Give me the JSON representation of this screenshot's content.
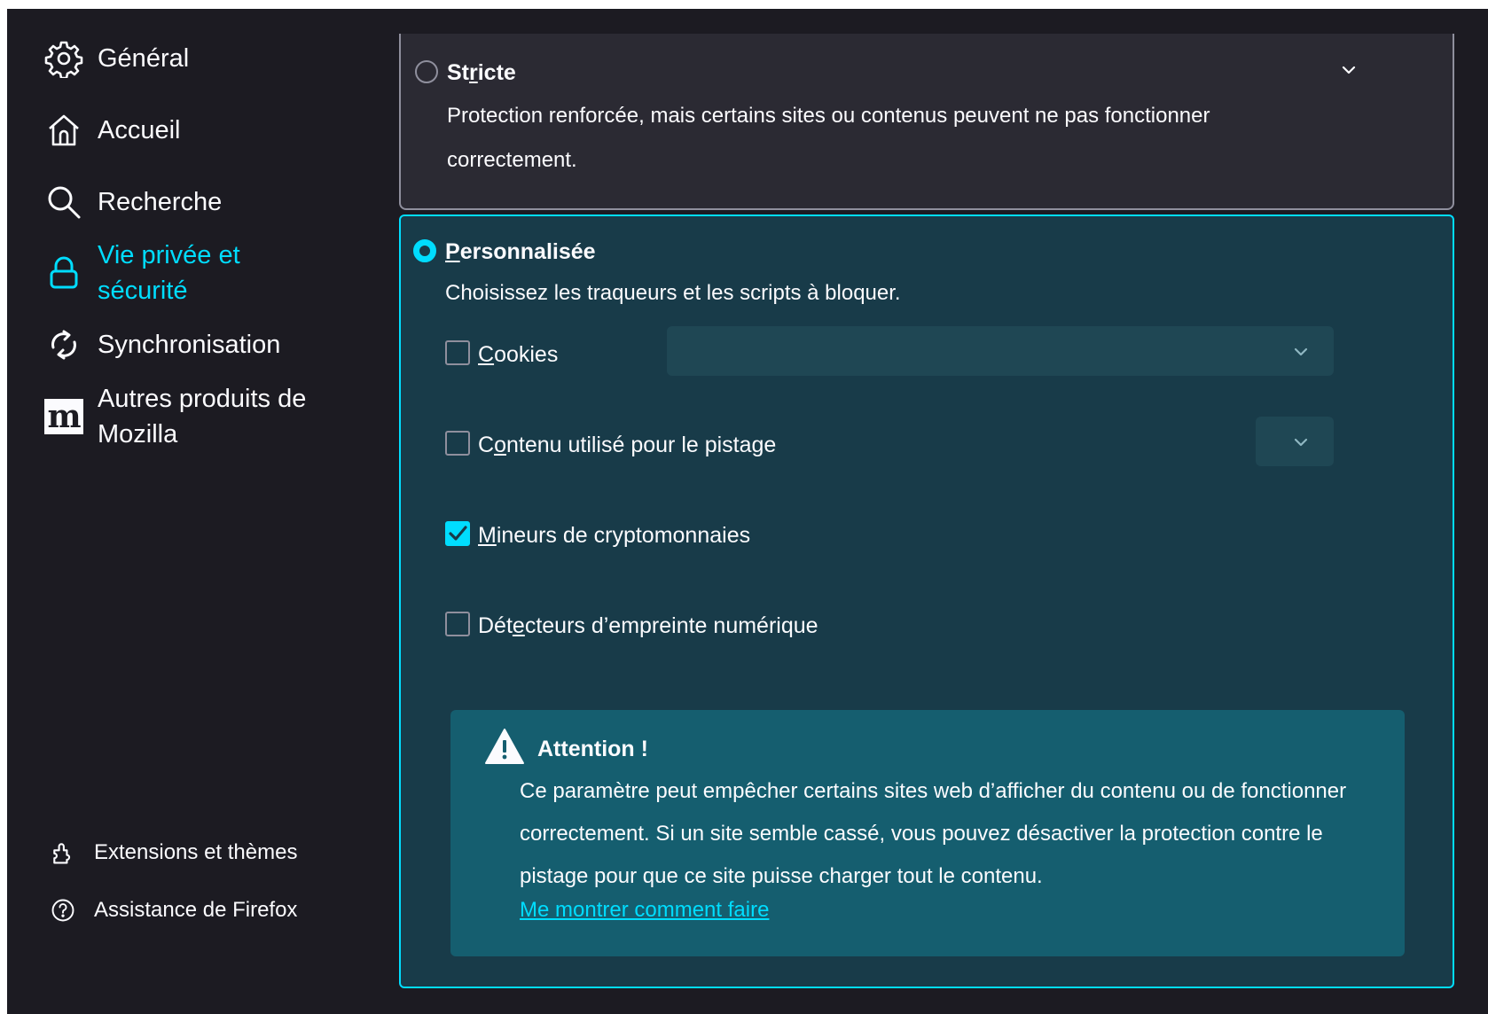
{
  "colors": {
    "background": "#1c1b22",
    "accent": "#00ddff",
    "text": "#fbfbfe",
    "card": "#2b2a33",
    "selected_card": "#183b49",
    "warning_box": "#155e6f"
  },
  "sidebar": {
    "items": [
      {
        "label": "Général",
        "icon": "gear-icon"
      },
      {
        "label": "Accueil",
        "icon": "home-icon"
      },
      {
        "label": "Recherche",
        "icon": "search-icon"
      },
      {
        "label_line1": "Vie privée et",
        "label_line2": "sécurité",
        "icon": "lock-icon",
        "selected": true
      },
      {
        "label": "Synchronisation",
        "icon": "sync-icon"
      },
      {
        "label_line1": "Autres produits de",
        "label_line2": "Mozilla",
        "icon": "mozilla-icon"
      }
    ],
    "footer": [
      {
        "label": "Extensions et thèmes",
        "icon": "puzzle-icon"
      },
      {
        "label": "Assistance de Firefox",
        "icon": "help-icon"
      }
    ]
  },
  "strict": {
    "title_pre": "St",
    "title_ul": "r",
    "title_post": "icte",
    "description": "Protection renforcée, mais certains sites ou contenus peuvent ne pas fonctionner correctement."
  },
  "custom": {
    "title_ul": "P",
    "title_post": "ersonnalisée",
    "description": "Choisissez les traqueurs et les scripts à bloquer.",
    "options": [
      {
        "ul": "C",
        "post": "ookies",
        "checked": false
      },
      {
        "pre": "C",
        "ul": "o",
        "post": "ntenu utilisé pour le pistage",
        "checked": false
      },
      {
        "ul": "M",
        "post": "ineurs de cryptomonnaies",
        "checked": true
      },
      {
        "pre": "Dét",
        "ul": "e",
        "post": "cteurs d’empreinte numérique",
        "checked": false
      }
    ],
    "warning": {
      "title": "Attention !",
      "text": "Ce paramètre peut empêcher certains sites web d’afficher du contenu ou de fonctionner correctement. Si un site semble cassé, vous pouvez désactiver la protection contre le pistage pour que ce site puisse charger tout le contenu.",
      "link": "Me montrer comment faire"
    }
  }
}
